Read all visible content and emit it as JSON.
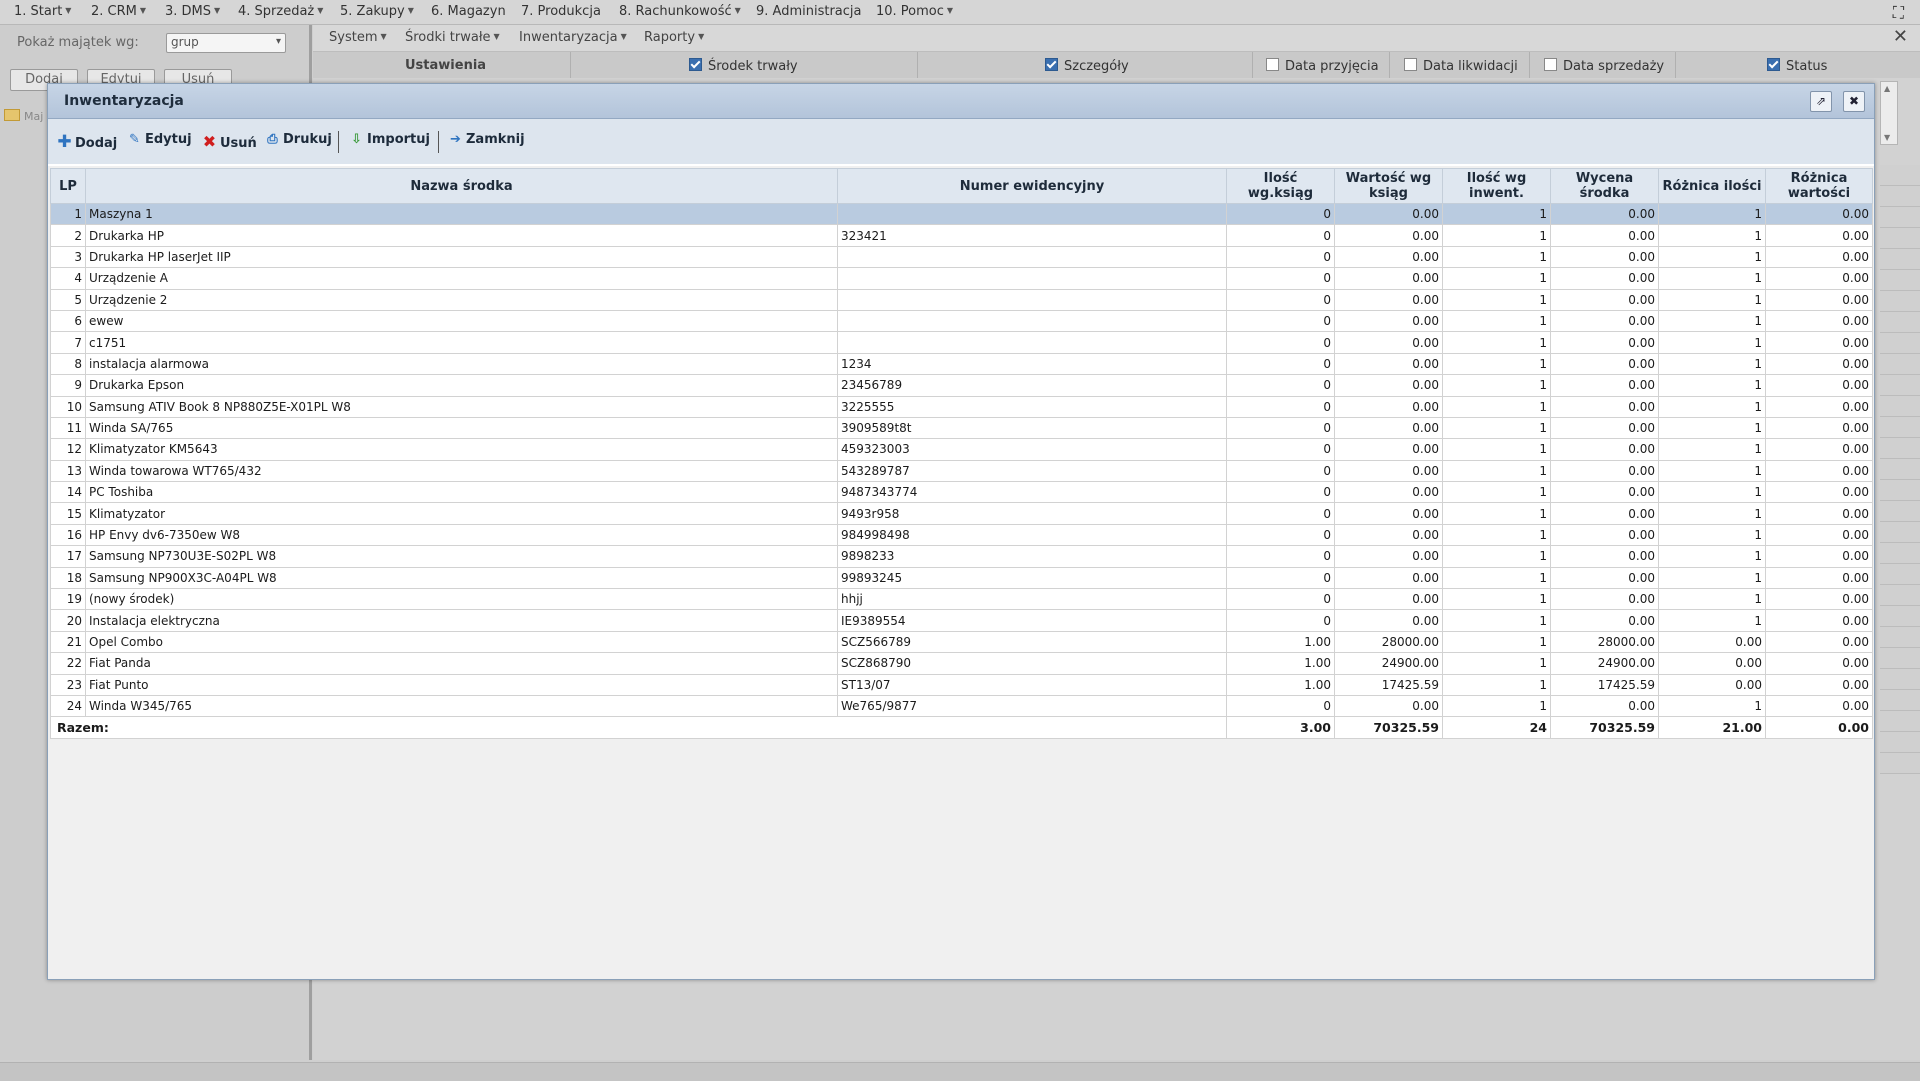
{
  "top_menu": [
    {
      "label": "1. Start",
      "caret": true
    },
    {
      "label": "2. CRM",
      "caret": true
    },
    {
      "label": "3. DMS",
      "caret": true
    },
    {
      "label": "4. Sprzedaż",
      "caret": true
    },
    {
      "label": "5. Zakupy",
      "caret": true
    },
    {
      "label": "6. Magazyn",
      "caret": false
    },
    {
      "label": "7. Produkcja",
      "caret": false
    },
    {
      "label": "8. Rachunkowość",
      "caret": true
    },
    {
      "label": "9. Administracja",
      "caret": false
    },
    {
      "label": "10. Pomoc",
      "caret": true
    }
  ],
  "left_panel": {
    "show_label": "Pokaż majątek wg:",
    "group_select": "grup",
    "buttons": [
      "Dodaj",
      "Edytuj",
      "Usuń"
    ],
    "tree_item": "Maj"
  },
  "sub_menu": [
    "System",
    "Środki trwałe",
    "Inwentaryzacja",
    "Raporty"
  ],
  "column_options": {
    "settings_label": "Ustawienia",
    "options": [
      {
        "label": "Środek trwały",
        "checked": true
      },
      {
        "label": "Szczegóły",
        "checked": true
      },
      {
        "label": "Data przyjęcia",
        "checked": false
      },
      {
        "label": "Data likwidacji",
        "checked": false
      },
      {
        "label": "Data sprzedaży",
        "checked": false
      },
      {
        "label": "Status",
        "checked": true
      }
    ]
  },
  "dialog": {
    "title": "Inwentaryzacja",
    "toolbar": [
      {
        "label": "Dodaj",
        "icon": "plus-icon"
      },
      {
        "label": "Edytuj",
        "icon": "pencil-icon"
      },
      {
        "label": "Usuń",
        "icon": "delete-x-icon"
      },
      {
        "label": "Drukuj",
        "icon": "printer-icon"
      },
      {
        "label": "Importuj",
        "icon": "import-icon"
      },
      {
        "label": "Zamknij",
        "icon": "exit-icon"
      }
    ],
    "columns": [
      "LP",
      "Nazwa środka",
      "Numer ewidencyjny",
      "Ilość wg.ksiąg",
      "Wartość wg ksiąg",
      "Ilość wg inwent.",
      "Wycena środka",
      "Różnica ilości",
      "Różnica wartości"
    ],
    "rows": [
      [
        "1",
        "Maszyna 1",
        "",
        "0",
        "0.00",
        "1",
        "0.00",
        "1",
        "0.00"
      ],
      [
        "2",
        "Drukarka HP",
        "323421",
        "0",
        "0.00",
        "1",
        "0.00",
        "1",
        "0.00"
      ],
      [
        "3",
        "Drukarka HP laserJet IIP",
        "",
        "0",
        "0.00",
        "1",
        "0.00",
        "1",
        "0.00"
      ],
      [
        "4",
        "Urządzenie A",
        "",
        "0",
        "0.00",
        "1",
        "0.00",
        "1",
        "0.00"
      ],
      [
        "5",
        "Urządzenie 2",
        "",
        "0",
        "0.00",
        "1",
        "0.00",
        "1",
        "0.00"
      ],
      [
        "6",
        "ewew",
        "",
        "0",
        "0.00",
        "1",
        "0.00",
        "1",
        "0.00"
      ],
      [
        "7",
        "c1751",
        "",
        "0",
        "0.00",
        "1",
        "0.00",
        "1",
        "0.00"
      ],
      [
        "8",
        "instalacja alarmowa",
        "1234",
        "0",
        "0.00",
        "1",
        "0.00",
        "1",
        "0.00"
      ],
      [
        "9",
        "Drukarka Epson",
        "23456789",
        "0",
        "0.00",
        "1",
        "0.00",
        "1",
        "0.00"
      ],
      [
        "10",
        "Samsung ATIV Book 8 NP880Z5E-X01PL W8",
        "3225555",
        "0",
        "0.00",
        "1",
        "0.00",
        "1",
        "0.00"
      ],
      [
        "11",
        "Winda SA/765",
        "3909589t8t",
        "0",
        "0.00",
        "1",
        "0.00",
        "1",
        "0.00"
      ],
      [
        "12",
        "Klimatyzator KM5643",
        "459323003",
        "0",
        "0.00",
        "1",
        "0.00",
        "1",
        "0.00"
      ],
      [
        "13",
        "Winda towarowa WT765/432",
        "543289787",
        "0",
        "0.00",
        "1",
        "0.00",
        "1",
        "0.00"
      ],
      [
        "14",
        "PC Toshiba",
        "9487343774",
        "0",
        "0.00",
        "1",
        "0.00",
        "1",
        "0.00"
      ],
      [
        "15",
        "Klimatyzator",
        "9493r958",
        "0",
        "0.00",
        "1",
        "0.00",
        "1",
        "0.00"
      ],
      [
        "16",
        "HP Envy dv6-7350ew W8",
        "984998498",
        "0",
        "0.00",
        "1",
        "0.00",
        "1",
        "0.00"
      ],
      [
        "17",
        "Samsung NP730U3E-S02PL W8",
        "9898233",
        "0",
        "0.00",
        "1",
        "0.00",
        "1",
        "0.00"
      ],
      [
        "18",
        "Samsung NP900X3C-A04PL W8",
        "99893245",
        "0",
        "0.00",
        "1",
        "0.00",
        "1",
        "0.00"
      ],
      [
        "19",
        "(nowy środek)",
        "hhjj",
        "0",
        "0.00",
        "1",
        "0.00",
        "1",
        "0.00"
      ],
      [
        "20",
        "Instalacja elektryczna",
        "IE9389554",
        "0",
        "0.00",
        "1",
        "0.00",
        "1",
        "0.00"
      ],
      [
        "21",
        "Opel Combo",
        "SCZ566789",
        "1.00",
        "28000.00",
        "1",
        "28000.00",
        "0.00",
        "0.00"
      ],
      [
        "22",
        "Fiat Panda",
        "SCZ868790",
        "1.00",
        "24900.00",
        "1",
        "24900.00",
        "0.00",
        "0.00"
      ],
      [
        "23",
        "Fiat Punto",
        "ST13/07",
        "1.00",
        "17425.59",
        "1",
        "17425.59",
        "0.00",
        "0.00"
      ],
      [
        "24",
        "Winda W345/765",
        "We765/9877",
        "0",
        "0.00",
        "1",
        "0.00",
        "1",
        "0.00"
      ]
    ],
    "selected_row": 0,
    "total": {
      "label": "Razem:",
      "values": [
        "3.00",
        "70325.59",
        "24",
        "70325.59",
        "21.00",
        "0.00"
      ]
    }
  }
}
